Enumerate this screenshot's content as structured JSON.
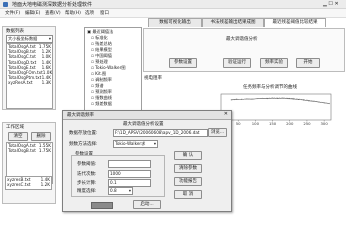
{
  "app": {
    "title": "地面大地电磁测深数据分析处理软件"
  },
  "menu": [
    "文件(F)",
    "编辑(E)",
    "查看(V)",
    "帮助(H)",
    "选项",
    "窗口"
  ],
  "left": {
    "data_list_title": "数据列表",
    "data_list_select": "大小极坐标数据",
    "data_files": [
      {
        "name": "TotalOsgA.txt",
        "size": "1.75K"
      },
      {
        "name": "TotalOsgB.txt",
        "size": "1.2K"
      },
      {
        "name": "TotalOsgC.txt",
        "size": "1.0K"
      },
      {
        "name": "TotalOsgD.txt",
        "size": "1.4K"
      },
      {
        "name": "TotalOsgE.txt",
        "size": "1.6K"
      },
      {
        "name": "TotalOsgFOm.txt",
        "size": "1.0K"
      },
      {
        "name": "TotalOsgPtm.txt",
        "size": "1.4K"
      },
      {
        "name": "xyzResA.txt",
        "size": "1.3K"
      }
    ],
    "work_area_title": "工作区域",
    "btn_clear": "清空",
    "btn_delete": "删除",
    "work_files": [
      {
        "name": "TotalOsgA.txt",
        "size": "1.55K"
      },
      {
        "name": "TotalOsgB.txt",
        "size": "1.75K"
      }
    ],
    "status_bottom": [
      {
        "name": "xyzresB.txt",
        "size": "1.4K"
      },
      {
        "name": "xyzresC.txt",
        "size": "1.2K"
      }
    ]
  },
  "tabs": [
    "数据可视化输出",
    "书法残差输出结果成图",
    "最近残差阈值比较结果"
  ],
  "tree": {
    "root": "最近阈值法",
    "items": [
      "标准化",
      "残差总结",
      "结果模型",
      "中国阈值",
      "预处理",
      "Tokio-Walker图",
      "Kit.图",
      "调制频率",
      "频谱",
      "预测频率",
      "指数曲线",
      "频差数据"
    ]
  },
  "method_panel": {
    "title": "最大调谐值分析",
    "buttons": [
      "参数设置",
      "验证运行",
      "频率实验",
      "开始"
    ]
  },
  "chart": {
    "y_axis_title": "视电阻率",
    "title": "任务频率与分析调节的曲线",
    "x_ticks": [
      "50",
      "100",
      "150",
      "200",
      "250",
      "300"
    ]
  },
  "chart_data": {
    "type": "line",
    "title": "任务频率与分析调节的曲线",
    "xlabel": "",
    "ylabel": "",
    "xlim": [
      0,
      320
    ],
    "ylim": [
      0,
      1
    ],
    "series": [
      {
        "values": [
          [
            30,
            0.78
          ],
          [
            45,
            0.8
          ],
          [
            60,
            0.79
          ],
          [
            75,
            0.81
          ],
          [
            90,
            0.8
          ],
          [
            105,
            0.82
          ],
          [
            120,
            0.83
          ],
          [
            135,
            0.82
          ],
          [
            150,
            0.84
          ],
          [
            165,
            0.83
          ],
          [
            180,
            0.84
          ],
          [
            195,
            0.82
          ],
          [
            210,
            0.81
          ],
          [
            225,
            0.79
          ],
          [
            240,
            0.77
          ],
          [
            255,
            0.74
          ],
          [
            270,
            0.72
          ],
          [
            285,
            0.69
          ],
          [
            300,
            0.66
          ],
          [
            315,
            0.63
          ]
        ]
      },
      {
        "values": [
          [
            30,
            0.77
          ],
          [
            60,
            0.8
          ],
          [
            90,
            0.81
          ],
          [
            120,
            0.83
          ],
          [
            150,
            0.85
          ],
          [
            180,
            0.85
          ],
          [
            210,
            0.83
          ],
          [
            240,
            0.79
          ],
          [
            270,
            0.73
          ],
          [
            300,
            0.67
          ],
          [
            315,
            0.64
          ]
        ]
      }
    ]
  },
  "dialog": {
    "title": "最大调谐频率",
    "subtitle": "最大调谐值分析设置",
    "fields": [
      {
        "label": "数据存放位置:",
        "value": "F:\\1D_APSV\\20060608\\apv_1D_2006.dat",
        "button": "浏览..."
      },
      {
        "label": "频数方法选择:",
        "value": "Tokio-Walker求"
      },
      {
        "label": "参数设置",
        "value": ""
      },
      {
        "label": "参数阈值:",
        "value": ""
      },
      {
        "label": "迭代次数:",
        "value": "1000"
      },
      {
        "label": "步长计算:",
        "value": "0.1"
      },
      {
        "label": "精度选择:",
        "value": "0.8"
      }
    ],
    "right_buttons": [
      "确 认",
      "清除参数",
      "功能报告",
      "取 消"
    ],
    "bottom_button": "启动..."
  }
}
